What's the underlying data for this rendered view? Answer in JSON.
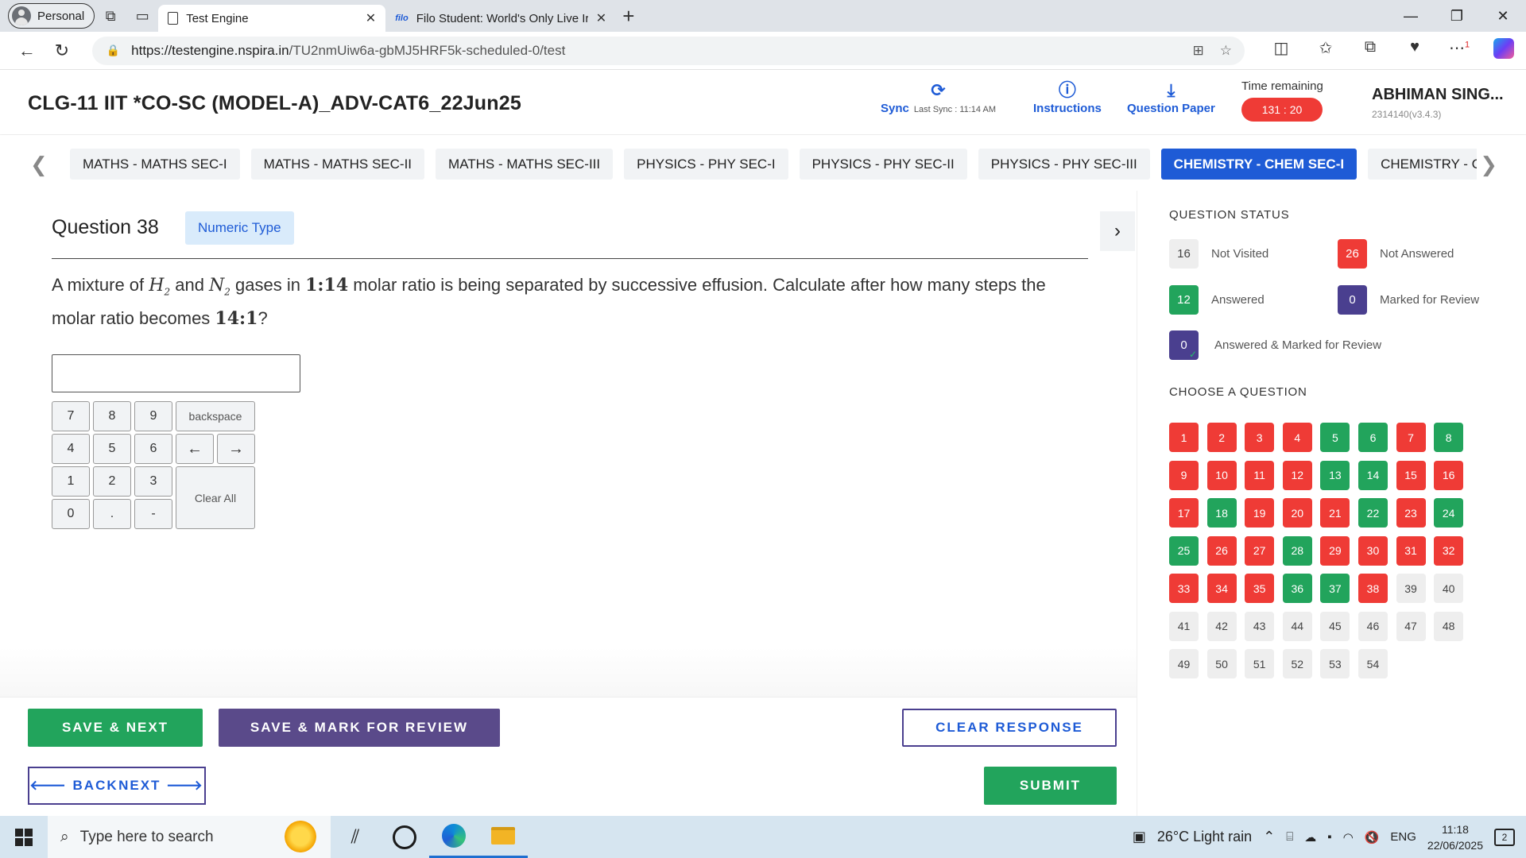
{
  "browser": {
    "profile_label": "Personal",
    "tabs": [
      {
        "title": "Test Engine",
        "active": true
      },
      {
        "favicon_text": "filo",
        "title": "Filo Student: World's Only Live Ir",
        "active": false
      }
    ],
    "url_host": "https://testengine.nspira.in",
    "url_path": "/TU2nmUiw6a-gbMJ5HRF5k-scheduled-0/test",
    "extension_badge": "1"
  },
  "header": {
    "exam_title": "CLG-11 IIT *CO-SC (MODEL-A)_ADV-CAT6_22Jun25",
    "sync_label": "Sync",
    "last_sync": "Last Sync : 11:14 AM",
    "instructions_label": "Instructions",
    "question_paper_label": "Question Paper",
    "time_remaining_label": "Time remaining",
    "time_remaining": "131 : 20",
    "user_name": "ABHIMAN SING...",
    "user_id": "2314140(v3.4.3)"
  },
  "sections": [
    {
      "label": "MATHS - MATHS SEC-I",
      "active": false
    },
    {
      "label": "MATHS - MATHS SEC-II",
      "active": false
    },
    {
      "label": "MATHS - MATHS SEC-III",
      "active": false
    },
    {
      "label": "PHYSICS - PHY SEC-I",
      "active": false
    },
    {
      "label": "PHYSICS - PHY SEC-II",
      "active": false
    },
    {
      "label": "PHYSICS - PHY SEC-III",
      "active": false
    },
    {
      "label": "CHEMISTRY - CHEM SEC-I",
      "active": true
    },
    {
      "label": "CHEMISTRY - CHEM SEC-II",
      "active": false
    }
  ],
  "question": {
    "title": "Question 38",
    "type_badge": "Numeric Type",
    "text_1": "A mixture of ",
    "h2": "H",
    "h2_sub": "2",
    "text_2": " and ",
    "n2": "N",
    "n2_sub": "2",
    "text_3": " gases in ",
    "ratio_1": "1:14",
    "text_4": " molar ratio is being separated by successive effusion.  Calculate after how many steps the molar ratio becomes ",
    "ratio_2": "14:1",
    "text_5": "?",
    "answer_value": ""
  },
  "keypad": {
    "k7": "7",
    "k8": "8",
    "k9": "9",
    "backspace": "backspace",
    "k4": "4",
    "k5": "5",
    "k6": "6",
    "left": "←",
    "right": "→",
    "k1": "1",
    "k2": "2",
    "k3": "3",
    "clear_all": "Clear All",
    "k0": "0",
    "dot": ".",
    "minus": "-"
  },
  "actions": {
    "save_next": "SAVE & NEXT",
    "save_mark": "SAVE & MARK FOR REVIEW",
    "clear_response": "CLEAR RESPONSE",
    "back": "BACK",
    "next": "NEXT",
    "submit": "SUBMIT"
  },
  "status": {
    "heading": "QUESTION STATUS",
    "not_visited_count": "16",
    "not_visited_label": "Not Visited",
    "not_answered_count": "26",
    "not_answered_label": "Not Answered",
    "answered_count": "12",
    "answered_label": "Answered",
    "marked_count": "0",
    "marked_label": "Marked for Review",
    "answered_marked_count": "0",
    "answered_marked_label": "Answered & Marked for Review",
    "choose_heading": "CHOOSE A QUESTION",
    "colors": {
      "not_answered": "#ef3b36",
      "answered": "#22a45c",
      "not_visited": "#eeeeee",
      "marked": "#4a3f8f"
    }
  },
  "question_palette": [
    {
      "n": "1",
      "s": "na"
    },
    {
      "n": "2",
      "s": "na"
    },
    {
      "n": "3",
      "s": "na"
    },
    {
      "n": "4",
      "s": "na"
    },
    {
      "n": "5",
      "s": "an"
    },
    {
      "n": "6",
      "s": "an"
    },
    {
      "n": "7",
      "s": "na"
    },
    {
      "n": "8",
      "s": "an"
    },
    {
      "n": "9",
      "s": "na"
    },
    {
      "n": "10",
      "s": "na"
    },
    {
      "n": "11",
      "s": "na"
    },
    {
      "n": "12",
      "s": "na"
    },
    {
      "n": "13",
      "s": "an"
    },
    {
      "n": "14",
      "s": "an"
    },
    {
      "n": "15",
      "s": "na"
    },
    {
      "n": "16",
      "s": "na"
    },
    {
      "n": "17",
      "s": "na"
    },
    {
      "n": "18",
      "s": "an"
    },
    {
      "n": "19",
      "s": "na"
    },
    {
      "n": "20",
      "s": "na"
    },
    {
      "n": "21",
      "s": "na"
    },
    {
      "n": "22",
      "s": "an"
    },
    {
      "n": "23",
      "s": "na"
    },
    {
      "n": "24",
      "s": "an"
    },
    {
      "n": "25",
      "s": "an"
    },
    {
      "n": "26",
      "s": "na"
    },
    {
      "n": "27",
      "s": "na"
    },
    {
      "n": "28",
      "s": "an"
    },
    {
      "n": "29",
      "s": "na"
    },
    {
      "n": "30",
      "s": "na"
    },
    {
      "n": "31",
      "s": "na"
    },
    {
      "n": "32",
      "s": "na"
    },
    {
      "n": "33",
      "s": "na"
    },
    {
      "n": "34",
      "s": "na"
    },
    {
      "n": "35",
      "s": "na"
    },
    {
      "n": "36",
      "s": "an"
    },
    {
      "n": "37",
      "s": "an"
    },
    {
      "n": "38",
      "s": "na"
    },
    {
      "n": "39",
      "s": "nv"
    },
    {
      "n": "40",
      "s": "nv"
    },
    {
      "n": "41",
      "s": "nv"
    },
    {
      "n": "42",
      "s": "nv"
    },
    {
      "n": "43",
      "s": "nv"
    },
    {
      "n": "44",
      "s": "nv"
    },
    {
      "n": "45",
      "s": "nv"
    },
    {
      "n": "46",
      "s": "nv"
    },
    {
      "n": "47",
      "s": "nv"
    },
    {
      "n": "48",
      "s": "nv"
    },
    {
      "n": "49",
      "s": "nv"
    },
    {
      "n": "50",
      "s": "nv"
    },
    {
      "n": "51",
      "s": "nv"
    },
    {
      "n": "52",
      "s": "nv"
    },
    {
      "n": "53",
      "s": "nv"
    },
    {
      "n": "54",
      "s": "nv"
    }
  ],
  "taskbar": {
    "search_placeholder": "Type here to search",
    "weather": "26°C  Light rain",
    "language": "ENG",
    "time": "11:18",
    "date": "22/06/2025",
    "notification_count": "2"
  }
}
